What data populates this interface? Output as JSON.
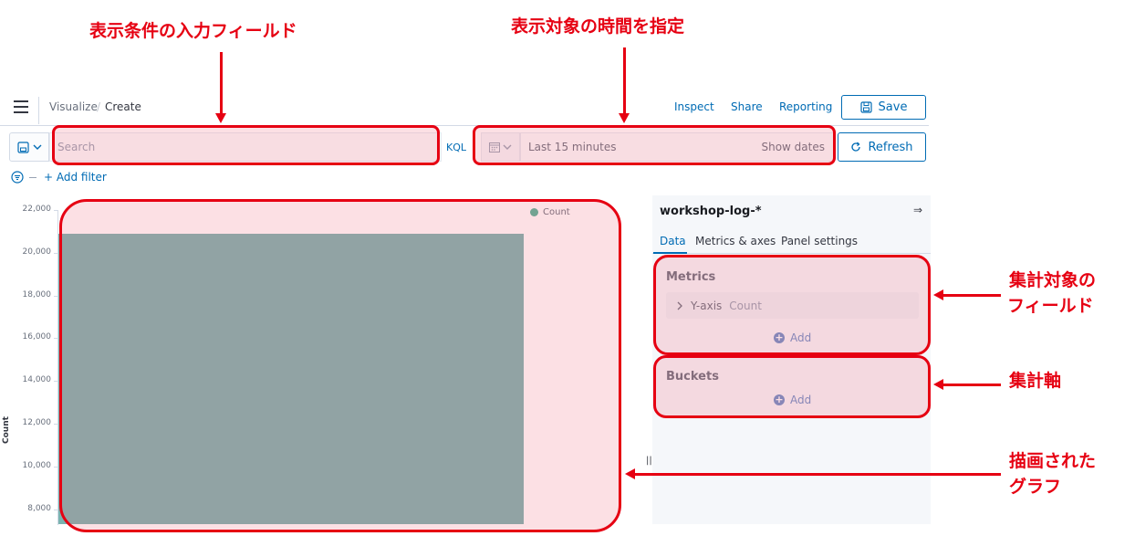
{
  "annotations": {
    "query_field": "表示条件の入力フィールド",
    "time_range": "表示対象の時間を指定",
    "metrics_field_line1": "集計対象の",
    "metrics_field_line2": "フィールド",
    "buckets_axis": "集計軸",
    "graph_line1": "描画された",
    "graph_line2": "グラフ",
    "highlight_color": "#e60012"
  },
  "header": {
    "breadcrumb_parent": "Visualize",
    "breadcrumb_separator": "/",
    "breadcrumb_current": "Create",
    "inspect": "Inspect",
    "share": "Share",
    "reporting": "Reporting",
    "save": "Save"
  },
  "query_bar": {
    "search_placeholder": "Search",
    "language": "KQL",
    "time_range": "Last 15 minutes",
    "show_dates": "Show dates",
    "refresh": "Refresh",
    "add_filter": "+ Add filter"
  },
  "chart_data": {
    "type": "bar",
    "categories": [
      ""
    ],
    "series": [
      {
        "name": "Count",
        "values": [
          20900
        ]
      }
    ],
    "ylabel": "Count",
    "yticks": [
      "22,000",
      "20,000",
      "18,000",
      "16,000",
      "14,000",
      "12,000",
      "10,000",
      "8,000"
    ],
    "ylim": [
      7300,
      22000
    ],
    "legend_position": "top-right",
    "bar_color": "#7ab3b0",
    "legend_color": "#54b399",
    "axis_accent_color": "#00a69b"
  },
  "sidebar": {
    "index_pattern": "workshop-log-*",
    "tabs": [
      "Data",
      "Metrics & axes",
      "Panel settings"
    ],
    "metrics_title": "Metrics",
    "metric_item_axis": "Y-axis",
    "metric_item_agg": "Count",
    "buckets_title": "Buckets",
    "add_label": "Add"
  }
}
